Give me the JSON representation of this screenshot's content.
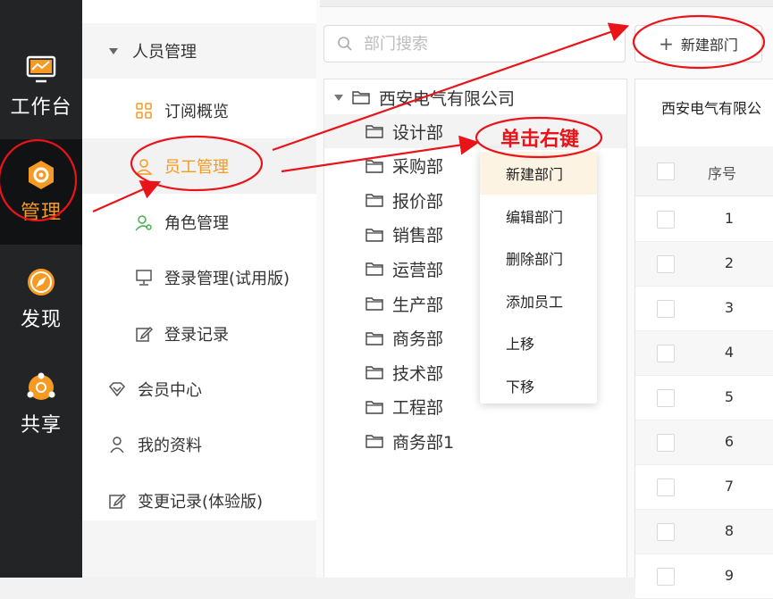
{
  "rail": [
    {
      "label": "工作台",
      "icon": "monitor-icon"
    },
    {
      "label": "管理",
      "icon": "hexagon-gear-icon"
    },
    {
      "label": "发现",
      "icon": "compass-icon"
    },
    {
      "label": "共享",
      "icon": "share-node-icon"
    }
  ],
  "menu": {
    "group_label": "人员管理",
    "sub_items": [
      {
        "label": "订阅概览",
        "icon": "grid-icon"
      },
      {
        "label": "员工管理",
        "icon": "user-icon"
      },
      {
        "label": "角色管理",
        "icon": "user-settings-icon"
      },
      {
        "label": "登录管理(试用版)",
        "icon": "desktop-icon"
      },
      {
        "label": "登录记录",
        "icon": "edit-icon"
      }
    ],
    "top_items": [
      {
        "label": "会员中心",
        "icon": "diamond-icon"
      },
      {
        "label": "我的资料",
        "icon": "person-icon"
      },
      {
        "label": "变更记录(体验版)",
        "icon": "edit-icon"
      }
    ]
  },
  "search": {
    "placeholder": "部门搜索"
  },
  "new_dept_button": "新建部门",
  "tree": {
    "root": "西安电气有限公司",
    "children": [
      "设计部",
      "采购部",
      "报价部",
      "销售部",
      "运营部",
      "生产部",
      "商务部",
      "技术部",
      "工程部",
      "商务部1"
    ]
  },
  "company_tab": "西安电气有限公",
  "table": {
    "seq_header": "序号",
    "rows": [
      "1",
      "2",
      "3",
      "4",
      "5",
      "6",
      "7",
      "8",
      "9"
    ]
  },
  "context_menu": [
    "新建部门",
    "编辑部门",
    "删除部门",
    "添加员工",
    "上移",
    "下移"
  ],
  "annotation": {
    "label": "单击右键",
    "color": "#e8141a"
  },
  "colors": {
    "accent": "#f59a23",
    "rail_bg": "#222426"
  }
}
